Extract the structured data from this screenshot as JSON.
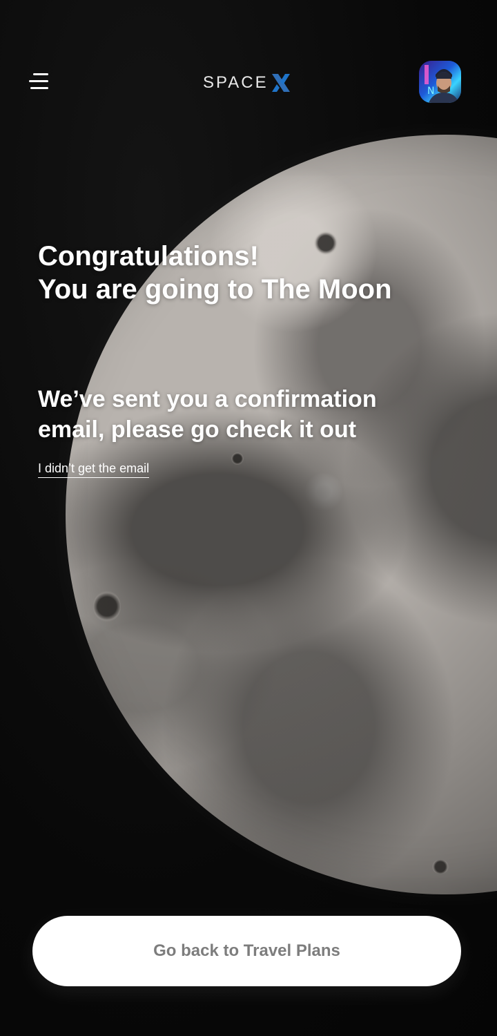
{
  "header": {
    "logo": {
      "text": "SPACE",
      "mark": "X",
      "mark_color": "#1f74c9"
    },
    "menu_icon": "hamburger-icon",
    "avatar_icon": "user-avatar"
  },
  "main": {
    "title_line_1": "Congratulations!",
    "title_line_2": "You are going to The Moon",
    "subtitle_line_1": "We’ve sent you a confirmation",
    "subtitle_line_2": "email, please go check it out",
    "email_link": "I didn’t get the email"
  },
  "footer": {
    "back_button_label": "Go back to Travel Plans"
  },
  "colors": {
    "background": "#080808",
    "text": "#ffffff",
    "button_bg": "#ffffff",
    "button_text": "#7d7d7d",
    "accent": "#1f74c9"
  }
}
